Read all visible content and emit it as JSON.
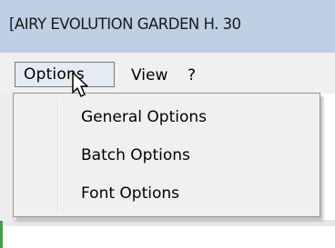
{
  "window": {
    "title": "[AIRY EVOLUTION GARDEN H. 30"
  },
  "menubar": {
    "items": [
      {
        "label": "Options"
      },
      {
        "label": "View"
      },
      {
        "label": "?"
      }
    ]
  },
  "dropdown": {
    "items": [
      {
        "label": "General Options"
      },
      {
        "label": "Batch Options"
      },
      {
        "label": "Font Options"
      }
    ]
  },
  "colors": {
    "titlebar": "#bfcfe4",
    "menubar": "#f0f0f0",
    "menu_highlight": "#e5ebf3"
  },
  "icons": [
    "mouse-pointer-icon"
  ]
}
